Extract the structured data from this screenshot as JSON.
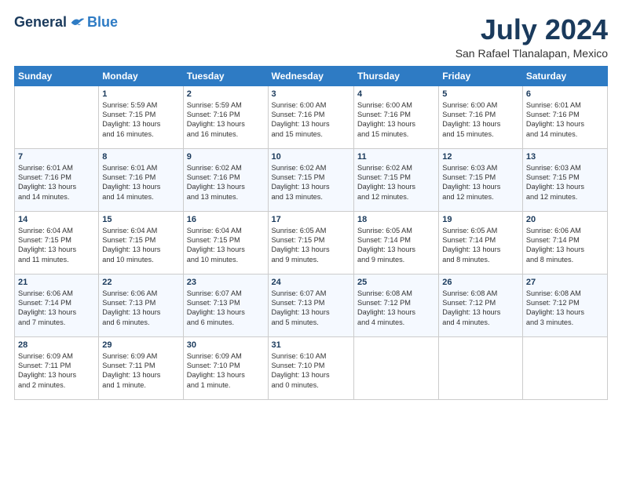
{
  "logo": {
    "general": "General",
    "blue": "Blue"
  },
  "title": "July 2024",
  "location": "San Rafael Tlanalapan, Mexico",
  "headers": [
    "Sunday",
    "Monday",
    "Tuesday",
    "Wednesday",
    "Thursday",
    "Friday",
    "Saturday"
  ],
  "weeks": [
    [
      {
        "day": "",
        "info": ""
      },
      {
        "day": "1",
        "info": "Sunrise: 5:59 AM\nSunset: 7:15 PM\nDaylight: 13 hours\nand 16 minutes."
      },
      {
        "day": "2",
        "info": "Sunrise: 5:59 AM\nSunset: 7:16 PM\nDaylight: 13 hours\nand 16 minutes."
      },
      {
        "day": "3",
        "info": "Sunrise: 6:00 AM\nSunset: 7:16 PM\nDaylight: 13 hours\nand 15 minutes."
      },
      {
        "day": "4",
        "info": "Sunrise: 6:00 AM\nSunset: 7:16 PM\nDaylight: 13 hours\nand 15 minutes."
      },
      {
        "day": "5",
        "info": "Sunrise: 6:00 AM\nSunset: 7:16 PM\nDaylight: 13 hours\nand 15 minutes."
      },
      {
        "day": "6",
        "info": "Sunrise: 6:01 AM\nSunset: 7:16 PM\nDaylight: 13 hours\nand 14 minutes."
      }
    ],
    [
      {
        "day": "7",
        "info": "Sunrise: 6:01 AM\nSunset: 7:16 PM\nDaylight: 13 hours\nand 14 minutes."
      },
      {
        "day": "8",
        "info": "Sunrise: 6:01 AM\nSunset: 7:16 PM\nDaylight: 13 hours\nand 14 minutes."
      },
      {
        "day": "9",
        "info": "Sunrise: 6:02 AM\nSunset: 7:16 PM\nDaylight: 13 hours\nand 13 minutes."
      },
      {
        "day": "10",
        "info": "Sunrise: 6:02 AM\nSunset: 7:15 PM\nDaylight: 13 hours\nand 13 minutes."
      },
      {
        "day": "11",
        "info": "Sunrise: 6:02 AM\nSunset: 7:15 PM\nDaylight: 13 hours\nand 12 minutes."
      },
      {
        "day": "12",
        "info": "Sunrise: 6:03 AM\nSunset: 7:15 PM\nDaylight: 13 hours\nand 12 minutes."
      },
      {
        "day": "13",
        "info": "Sunrise: 6:03 AM\nSunset: 7:15 PM\nDaylight: 13 hours\nand 12 minutes."
      }
    ],
    [
      {
        "day": "14",
        "info": "Sunrise: 6:04 AM\nSunset: 7:15 PM\nDaylight: 13 hours\nand 11 minutes."
      },
      {
        "day": "15",
        "info": "Sunrise: 6:04 AM\nSunset: 7:15 PM\nDaylight: 13 hours\nand 10 minutes."
      },
      {
        "day": "16",
        "info": "Sunrise: 6:04 AM\nSunset: 7:15 PM\nDaylight: 13 hours\nand 10 minutes."
      },
      {
        "day": "17",
        "info": "Sunrise: 6:05 AM\nSunset: 7:15 PM\nDaylight: 13 hours\nand 9 minutes."
      },
      {
        "day": "18",
        "info": "Sunrise: 6:05 AM\nSunset: 7:14 PM\nDaylight: 13 hours\nand 9 minutes."
      },
      {
        "day": "19",
        "info": "Sunrise: 6:05 AM\nSunset: 7:14 PM\nDaylight: 13 hours\nand 8 minutes."
      },
      {
        "day": "20",
        "info": "Sunrise: 6:06 AM\nSunset: 7:14 PM\nDaylight: 13 hours\nand 8 minutes."
      }
    ],
    [
      {
        "day": "21",
        "info": "Sunrise: 6:06 AM\nSunset: 7:14 PM\nDaylight: 13 hours\nand 7 minutes."
      },
      {
        "day": "22",
        "info": "Sunrise: 6:06 AM\nSunset: 7:13 PM\nDaylight: 13 hours\nand 6 minutes."
      },
      {
        "day": "23",
        "info": "Sunrise: 6:07 AM\nSunset: 7:13 PM\nDaylight: 13 hours\nand 6 minutes."
      },
      {
        "day": "24",
        "info": "Sunrise: 6:07 AM\nSunset: 7:13 PM\nDaylight: 13 hours\nand 5 minutes."
      },
      {
        "day": "25",
        "info": "Sunrise: 6:08 AM\nSunset: 7:12 PM\nDaylight: 13 hours\nand 4 minutes."
      },
      {
        "day": "26",
        "info": "Sunrise: 6:08 AM\nSunset: 7:12 PM\nDaylight: 13 hours\nand 4 minutes."
      },
      {
        "day": "27",
        "info": "Sunrise: 6:08 AM\nSunset: 7:12 PM\nDaylight: 13 hours\nand 3 minutes."
      }
    ],
    [
      {
        "day": "28",
        "info": "Sunrise: 6:09 AM\nSunset: 7:11 PM\nDaylight: 13 hours\nand 2 minutes."
      },
      {
        "day": "29",
        "info": "Sunrise: 6:09 AM\nSunset: 7:11 PM\nDaylight: 13 hours\nand 1 minute."
      },
      {
        "day": "30",
        "info": "Sunrise: 6:09 AM\nSunset: 7:10 PM\nDaylight: 13 hours\nand 1 minute."
      },
      {
        "day": "31",
        "info": "Sunrise: 6:10 AM\nSunset: 7:10 PM\nDaylight: 13 hours\nand 0 minutes."
      },
      {
        "day": "",
        "info": ""
      },
      {
        "day": "",
        "info": ""
      },
      {
        "day": "",
        "info": ""
      }
    ]
  ]
}
